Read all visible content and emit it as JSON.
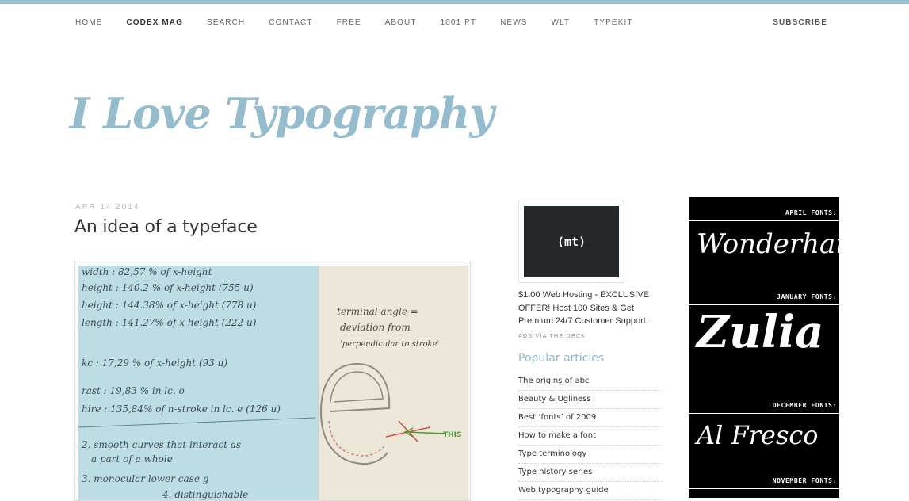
{
  "nav": {
    "items": [
      "HOME",
      "CODEX MAG",
      "SEARCH",
      "CONTACT",
      "FREE",
      "ABOUT",
      "1001 PT",
      "NEWS",
      "WLT",
      "TYPEKIT"
    ],
    "subscribe": "SUBSCRIBE"
  },
  "site": {
    "title": "I Love Typography"
  },
  "post": {
    "date": "APR 14 2014",
    "title": "An idea of a typeface",
    "sketch_notes": {
      "left": [
        "width : 82,57 % of x-height",
        "height : 140.2 % of x-height (755 u)",
        "height : 144.38% of x-height (778 u)",
        "length : 141.27% of x-height (222 u)",
        "kc : 17,29 % of x-height (93 u)",
        "rast : 19,83 % in lc. o",
        "hire : 135,84% of n-stroke in lc. e (126 u)",
        "2. smooth curves that interact as",
        "a part of a whole",
        "3. monocular lower case g",
        "4. distinguishable"
      ],
      "right": [
        "terminal angle =",
        "deviation from",
        "'perpendicular to stroke'",
        "THIS"
      ]
    }
  },
  "sidebar": {
    "ad_logo": "(mt)",
    "ad_text": "$1.00 Web Hosting - EXCLUSIVE OFFER! Host 100 Sites & Get Premium 24/7 Customer Support.",
    "ad_credit": "ADS VIA THE DECK",
    "popular_title": "Popular articles",
    "popular": [
      "The origins of abc",
      "Beauty & Ugliness",
      "Best ‘fonts’ of 2009",
      "How to make a font",
      "Type terminology",
      "Type history series",
      "Web typography guide"
    ]
  },
  "fonts": {
    "months": [
      "APRIL FONTS:",
      "JANUARY FONTS:",
      "DECEMBER FONTS:",
      "NOVEMBER FONTS:"
    ],
    "names": [
      "Wonderhand",
      "Zulia",
      "Al Fresco"
    ]
  },
  "colors": {
    "accent": "#94bccd",
    "top_bar": "#98bdcc",
    "sketch_blue": "#bcdde6",
    "sketch_paper": "#ece7d9"
  }
}
